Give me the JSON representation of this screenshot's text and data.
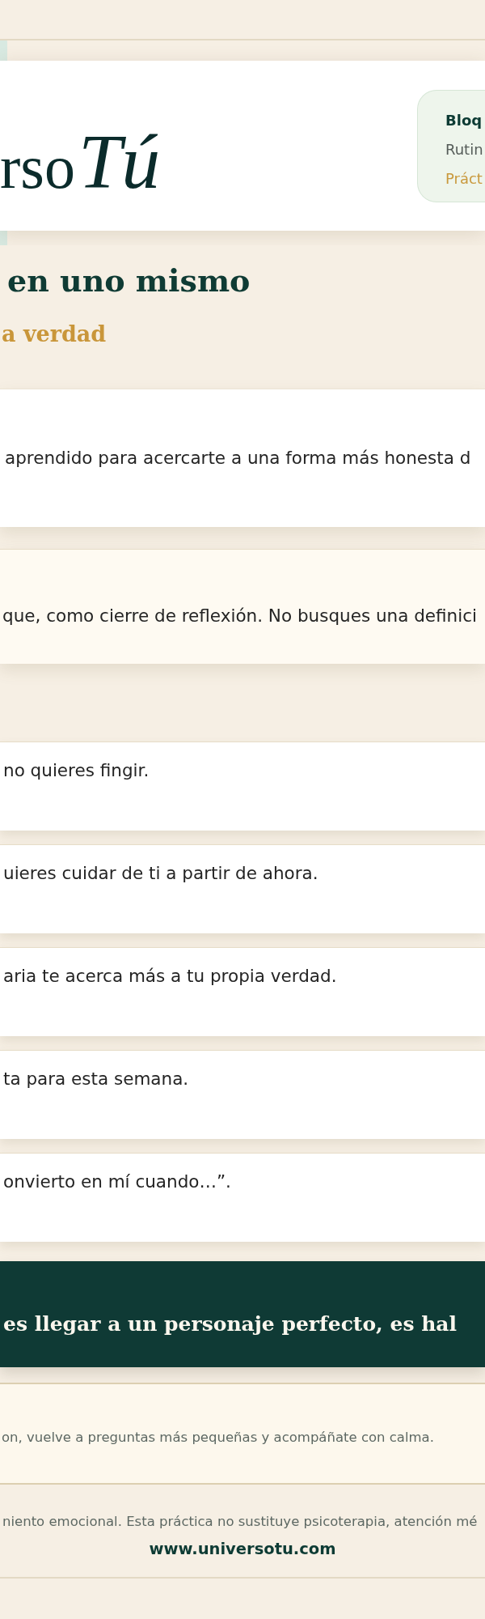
{
  "header": {
    "logo": {
      "serif_text": "rso",
      "script_text": "Tú"
    },
    "badge": {
      "title": "Bloq",
      "subtitle": "Rutin",
      "note": "Práct"
    }
  },
  "hero": {
    "title": "en uno mismo",
    "subtitle": "a verdad"
  },
  "intro_card": {
    "text": "aprendido para acercarte a una forma más honesta d"
  },
  "instruction_card": {
    "text": "que, como cierre de reflexión. No busques una definici"
  },
  "prompts": [
    {
      "text": "no quieres fingir."
    },
    {
      "text": "uieres cuidar de ti a partir de ahora."
    },
    {
      "text": "aria te acerca más a tu propia verdad."
    },
    {
      "text": "ta para esta semana."
    },
    {
      "text": "onvierto en mí cuando…”."
    }
  ],
  "quote_banner": {
    "text": "es llegar a un personaje perfecto, es hal"
  },
  "note": {
    "text": "on, vuelve a preguntas más pequeñas y acompáñate con calma."
  },
  "footer": {
    "disclaimer": "niento emocional. Esta práctica no sustituye psicoterapia, atención mé",
    "link": "www.universotu.com"
  }
}
